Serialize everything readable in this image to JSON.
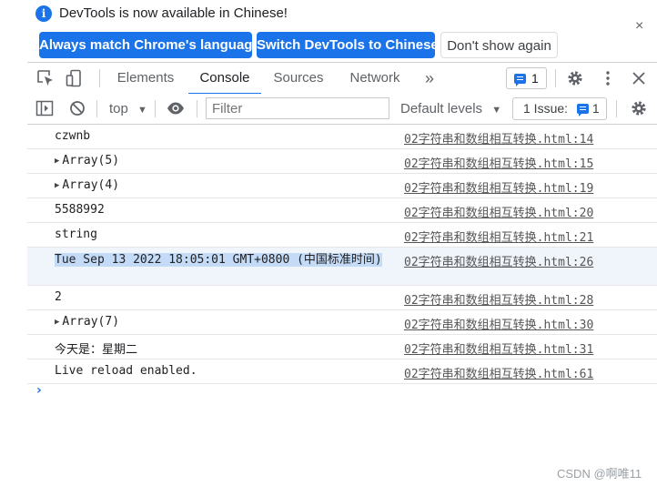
{
  "infobar": {
    "message": "DevTools is now available in Chinese!",
    "primary_btn_1": "Always match Chrome's language",
    "primary_btn_2": "Switch DevTools to Chinese",
    "secondary_btn": "Don't show again",
    "close_glyph": "×"
  },
  "tabs": [
    "Elements",
    "Console",
    "Sources",
    "Network"
  ],
  "active_tab": "Console",
  "more_tabs_glyph": "»",
  "message_count": "1",
  "toolbar": {
    "context": "top",
    "filter_placeholder": "Filter",
    "levels": "Default levels",
    "issues_label": "1 Issue:",
    "issues_count": "1"
  },
  "log": [
    {
      "text": "czwnb",
      "expandable": false,
      "source": "02字符串和数组相互转换.html:14"
    },
    {
      "text": "Array(5)",
      "expandable": true,
      "source": "02字符串和数组相互转换.html:15"
    },
    {
      "text": "Array(4)",
      "expandable": true,
      "source": "02字符串和数组相互转换.html:19"
    },
    {
      "text": "5588992",
      "expandable": false,
      "source": "02字符串和数组相互转换.html:20"
    },
    {
      "text": "string",
      "expandable": false,
      "source": "02字符串和数组相互转换.html:21"
    },
    {
      "text": "Tue Sep 13 2022 18:05:01 GMT+0800 (中国标准时间)",
      "expandable": false,
      "source": "02字符串和数组相互转换.html:26",
      "selected": true
    },
    {
      "text": "2",
      "expandable": false,
      "source": "02字符串和数组相互转换.html:28"
    },
    {
      "text": "Array(7)",
      "expandable": true,
      "source": "02字符串和数组相互转换.html:30"
    },
    {
      "text": "今天是：星期二",
      "expandable": false,
      "source": "02字符串和数组相互转换.html:31"
    },
    {
      "text": "Live reload enabled.",
      "expandable": false,
      "source": "02字符串和数组相互转换.html:61"
    }
  ],
  "prompt_glyph": "›",
  "watermark": "CSDN @啊唯11",
  "colors": {
    "accent": "#1a73e8",
    "selection": "#c4dbf7"
  }
}
